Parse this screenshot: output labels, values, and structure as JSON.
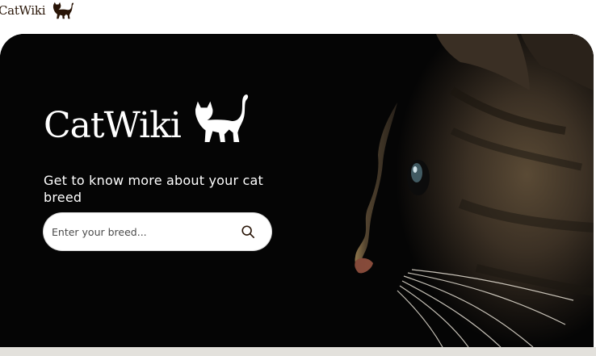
{
  "nav": {
    "logo_text": "CatWiki"
  },
  "hero": {
    "logo_text": "CatWiki",
    "tagline": "Get to know more about your cat breed"
  },
  "search": {
    "placeholder": "Enter your breed..."
  },
  "icons": {
    "cat": "cat-silhouette-icon",
    "search": "search-icon"
  },
  "colors": {
    "brand_dark": "#291507",
    "hero_bg": "#050505",
    "strip": "#e3e1dc"
  }
}
